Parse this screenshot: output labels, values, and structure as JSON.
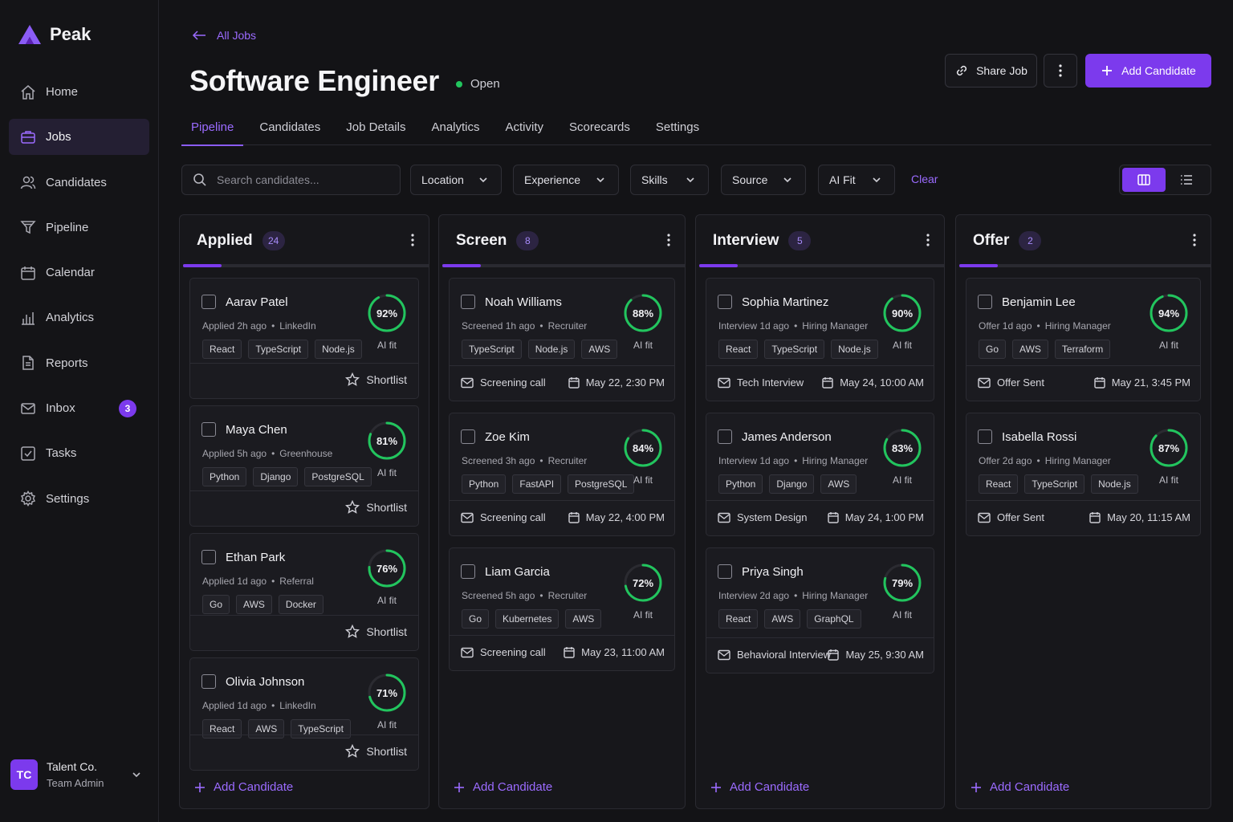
{
  "app": {
    "name": "Peak"
  },
  "sidebar": {
    "items": [
      {
        "label": "Home",
        "icon": "home-icon"
      },
      {
        "label": "Jobs",
        "icon": "briefcase-icon",
        "active": true
      },
      {
        "label": "Candidates",
        "icon": "users-icon"
      },
      {
        "label": "Pipeline",
        "icon": "funnel-icon"
      },
      {
        "label": "Calendar",
        "icon": "calendar-icon"
      },
      {
        "label": "Analytics",
        "icon": "bar-chart-icon"
      },
      {
        "label": "Reports",
        "icon": "document-icon"
      },
      {
        "label": "Inbox",
        "icon": "mail-icon",
        "badge": "3"
      },
      {
        "label": "Tasks",
        "icon": "checkbox-icon"
      },
      {
        "label": "Settings",
        "icon": "gear-icon"
      }
    ],
    "org": {
      "initials": "TC",
      "name": "Talent Co.",
      "role": "Team Admin"
    }
  },
  "header": {
    "back_label": "All Jobs",
    "title": "Software Engineer",
    "status": "Open",
    "share_label": "Share Job",
    "add_label": "Add Candidate"
  },
  "tabs": [
    "Pipeline",
    "Candidates",
    "Job Details",
    "Analytics",
    "Activity",
    "Scorecards",
    "Settings"
  ],
  "filters": {
    "search_placeholder": "Search candidates...",
    "dropdowns": [
      "Location",
      "Experience",
      "Skills",
      "Source",
      "AI Fit"
    ],
    "clear_label": "Clear"
  },
  "labels": {
    "ai_fit": "AI fit",
    "shortlist": "Shortlist",
    "add_candidate": "Add Candidate"
  },
  "colors": {
    "accent": "#7c3aed",
    "success": "#22c55e",
    "background": "#131316"
  },
  "columns": [
    {
      "title": "Applied",
      "count": "24",
      "cards": [
        {
          "name": "Aarav Patel",
          "stage": "Applied 2h ago",
          "source": "LinkedIn",
          "tags": [
            "React",
            "TypeScript",
            "Node.js"
          ],
          "fit": 92
        },
        {
          "name": "Maya Chen",
          "stage": "Applied 5h ago",
          "source": "Greenhouse",
          "tags": [
            "Python",
            "Django",
            "PostgreSQL"
          ],
          "fit": 81
        },
        {
          "name": "Ethan Park",
          "stage": "Applied 1d ago",
          "source": "Referral",
          "tags": [
            "Go",
            "AWS",
            "Docker"
          ],
          "fit": 76
        },
        {
          "name": "Olivia Johnson",
          "stage": "Applied 1d ago",
          "source": "LinkedIn",
          "tags": [
            "React",
            "AWS",
            "TypeScript"
          ],
          "fit": 71
        }
      ]
    },
    {
      "title": "Screen",
      "count": "8",
      "cards": [
        {
          "name": "Noah Williams",
          "stage": "Screened 1h ago",
          "source": "Recruiter",
          "tags": [
            "TypeScript",
            "Node.js",
            "AWS"
          ],
          "fit": 88,
          "event": "Screening call",
          "date": "May 22, 2:30 PM"
        },
        {
          "name": "Zoe Kim",
          "stage": "Screened 3h ago",
          "source": "Recruiter",
          "tags": [
            "Python",
            "FastAPI",
            "PostgreSQL"
          ],
          "fit": 84,
          "event": "Screening call",
          "date": "May 22, 4:00 PM"
        },
        {
          "name": "Liam Garcia",
          "stage": "Screened 5h ago",
          "source": "Recruiter",
          "tags": [
            "Go",
            "Kubernetes",
            "AWS"
          ],
          "fit": 72,
          "event": "Screening call",
          "date": "May 23, 11:00 AM"
        }
      ]
    },
    {
      "title": "Interview",
      "count": "5",
      "cards": [
        {
          "name": "Sophia Martinez",
          "stage": "Interview 1d ago",
          "source": "Hiring Manager",
          "tags": [
            "React",
            "TypeScript",
            "Node.js"
          ],
          "fit": 90,
          "event": "Tech Interview",
          "date": "May 24, 10:00 AM"
        },
        {
          "name": "James Anderson",
          "stage": "Interview 1d ago",
          "source": "Hiring Manager",
          "tags": [
            "Python",
            "Django",
            "AWS"
          ],
          "fit": 83,
          "event": "System Design",
          "date": "May 24, 1:00 PM"
        },
        {
          "name": "Priya Singh",
          "stage": "Interview 2d ago",
          "source": "Hiring Manager",
          "tags": [
            "React",
            "AWS",
            "GraphQL"
          ],
          "fit": 79,
          "event": "Behavioral Interview",
          "date": "May 25, 9:30 AM"
        }
      ]
    },
    {
      "title": "Offer",
      "count": "2",
      "cards": [
        {
          "name": "Benjamin Lee",
          "stage": "Offer 1d ago",
          "source": "Hiring Manager",
          "tags": [
            "Go",
            "AWS",
            "Terraform"
          ],
          "fit": 94,
          "event": "Offer Sent",
          "date": "May 21, 3:45 PM"
        },
        {
          "name": "Isabella Rossi",
          "stage": "Offer 2d ago",
          "source": "Hiring Manager",
          "tags": [
            "React",
            "TypeScript",
            "Node.js"
          ],
          "fit": 87,
          "event": "Offer Sent",
          "date": "May 20, 11:15 AM"
        }
      ]
    }
  ]
}
